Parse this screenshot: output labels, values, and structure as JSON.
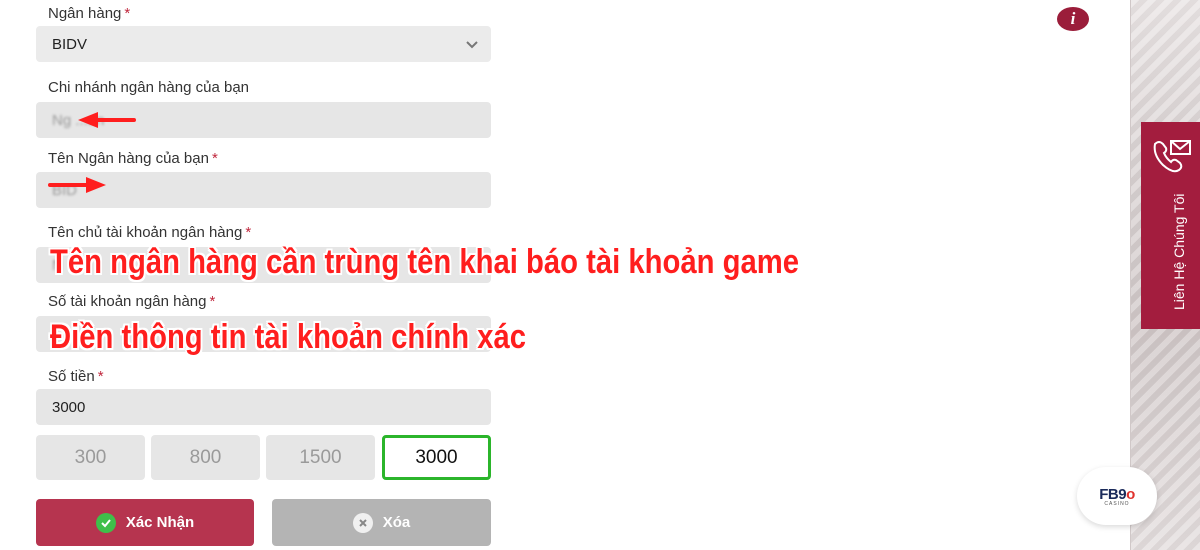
{
  "form": {
    "bank": {
      "label": "Ngân hàng",
      "required": "*",
      "value": "BIDV",
      "chevron_icon": "chevron-down-icon"
    },
    "branch": {
      "label": "Chi nhánh ngân hàng của bạn",
      "value": "Ng  ...an"
    },
    "bank_name": {
      "label": "Tên Ngân hàng của bạn",
      "required": "*",
      "value": "BID"
    },
    "account_holder": {
      "label": "Tên chủ tài khoản ngân hàng",
      "required": "*",
      "value": "N"
    },
    "account_number": {
      "label": "Số tài khoản ngân hàng",
      "required": "*",
      "value": ""
    },
    "amount": {
      "label": "Số tiền",
      "required": "*",
      "value": "3000"
    },
    "quick_amounts": [
      "300",
      "800",
      "1500",
      "3000"
    ],
    "selected_amount": "3000"
  },
  "buttons": {
    "confirm": "Xác Nhận",
    "clear": "Xóa"
  },
  "info_icon": "i",
  "contact_tab": {
    "label": "Liên Hệ Chúng Tôi",
    "icon": "phone-icon"
  },
  "logo": {
    "text": "FB9",
    "accent": "o",
    "sub": "CASINO"
  },
  "annotations": {
    "line1": "Tên ngân hàng cần trùng tên khai báo tài khoản game",
    "line2": "Điền thông tin tài khoản chính xác"
  },
  "colors": {
    "accent": "#b6344f",
    "contact": "#a31d3e",
    "selected_border": "#2bb52b",
    "annotation": "#ff1e1e"
  }
}
